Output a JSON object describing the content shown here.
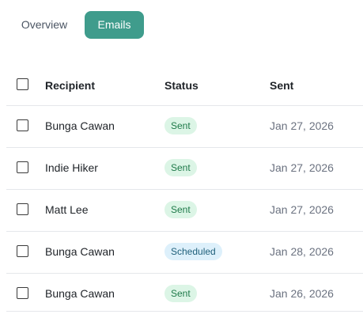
{
  "tabs": [
    {
      "label": "Overview",
      "active": false
    },
    {
      "label": "Emails",
      "active": true
    }
  ],
  "colors": {
    "accent": "#3f9c8c",
    "sent_badge_bg": "#dcf5e6",
    "scheduled_badge_bg": "#ddf0fb"
  },
  "table": {
    "columns": {
      "recipient": "Recipient",
      "status": "Status",
      "sent": "Sent"
    },
    "rows": [
      {
        "recipient": "Bunga Cawan",
        "status": "Sent",
        "sent": "Jan 27, 2026"
      },
      {
        "recipient": "Indie Hiker",
        "status": "Sent",
        "sent": "Jan 27, 2026"
      },
      {
        "recipient": "Matt Lee",
        "status": "Sent",
        "sent": "Jan 27, 2026"
      },
      {
        "recipient": "Bunga Cawan",
        "status": "Scheduled",
        "sent": "Jan 28, 2026"
      },
      {
        "recipient": "Bunga Cawan",
        "status": "Sent",
        "sent": "Jan 26, 2026"
      }
    ]
  }
}
